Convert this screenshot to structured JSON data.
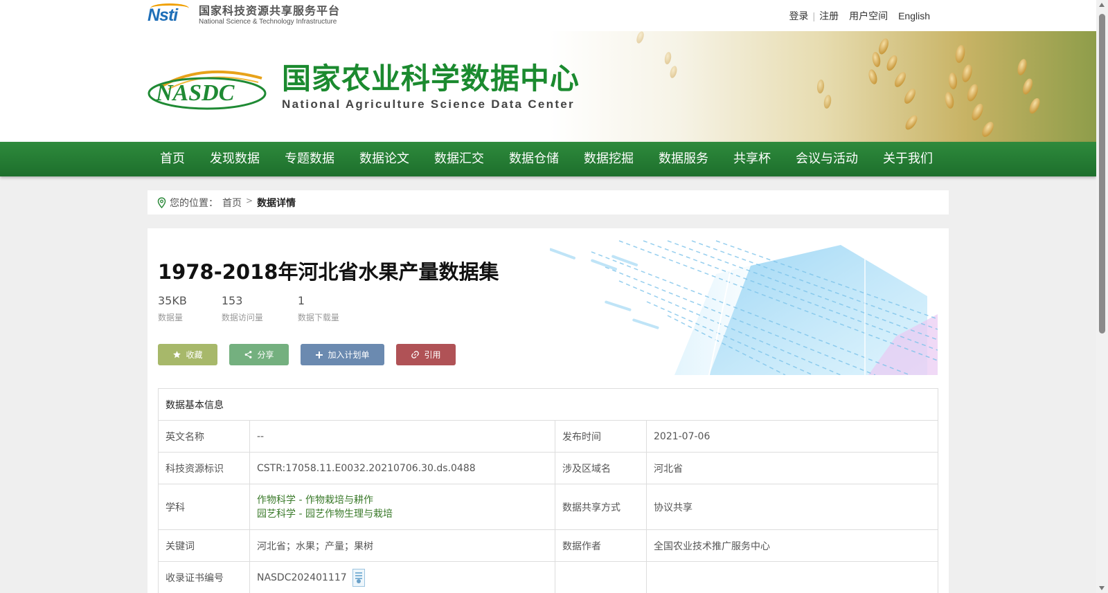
{
  "top": {
    "nsti_mark": "Nsti",
    "nsti_cn": "国家科技资源共享服务平台",
    "nsti_en": "National Science & Technology Infrastructure",
    "links": {
      "login": "登录",
      "register": "注册",
      "user_space": "用户空间",
      "english": "English"
    }
  },
  "banner": {
    "logo_text": "NASDC",
    "title_cn": "国家农业科学数据中心",
    "title_en": "National Agriculture Science Data Center"
  },
  "nav": {
    "items": [
      {
        "label": "首页"
      },
      {
        "label": "发现数据"
      },
      {
        "label": "专题数据"
      },
      {
        "label": "数据论文"
      },
      {
        "label": "数据汇交"
      },
      {
        "label": "数据仓储"
      },
      {
        "label": "数据挖掘"
      },
      {
        "label": "数据服务"
      },
      {
        "label": "共享杯"
      },
      {
        "label": "会议与活动"
      },
      {
        "label": "关于我们"
      }
    ]
  },
  "breadcrumb": {
    "prefix": "您的位置：",
    "home": "首页",
    "current": "数据详情"
  },
  "dataset": {
    "title": "1978-2018年河北省水果产量数据集",
    "stats": [
      {
        "value": "35KB",
        "label": "数据量"
      },
      {
        "value": "153",
        "label": "数据访问量"
      },
      {
        "value": "1",
        "label": "数据下载量"
      }
    ],
    "buttons": {
      "favorite": "收藏",
      "share": "分享",
      "add_plan": "加入计划单",
      "cite": "引用"
    },
    "colors": {
      "favorite": "#a7b86a",
      "share": "#74b07f",
      "add_plan": "#6b8ab0",
      "cite": "#b05256"
    }
  },
  "info": {
    "header": "数据基本信息",
    "rows": [
      {
        "k1": "英文名称",
        "v1": "--",
        "k2": "发布时间",
        "v2": "2021-07-06"
      },
      {
        "k1": "科技资源标识",
        "v1": "CSTR:17058.11.E0032.20210706.30.ds.0488",
        "k2": "涉及区域名",
        "v2": "河北省"
      },
      {
        "k1": "学科",
        "subjects": [
          "作物科学 - 作物栽培与耕作",
          "园艺科学 - 园艺作物生理与栽培"
        ],
        "k2": "数据共享方式",
        "v2": "协议共享"
      },
      {
        "k1": "关键词",
        "v1": "河北省；水果；产量；果树",
        "k2": "数据作者",
        "v2": "全国农业技术推广服务中心"
      },
      {
        "k1": "收录证书编号",
        "v1": "NASDC202401117",
        "k2": "",
        "v2": ""
      }
    ]
  },
  "theme": {
    "nav_green": "#2e8a3c",
    "title_green": "#1b8a2f",
    "link_green": "#3a7a2a"
  }
}
